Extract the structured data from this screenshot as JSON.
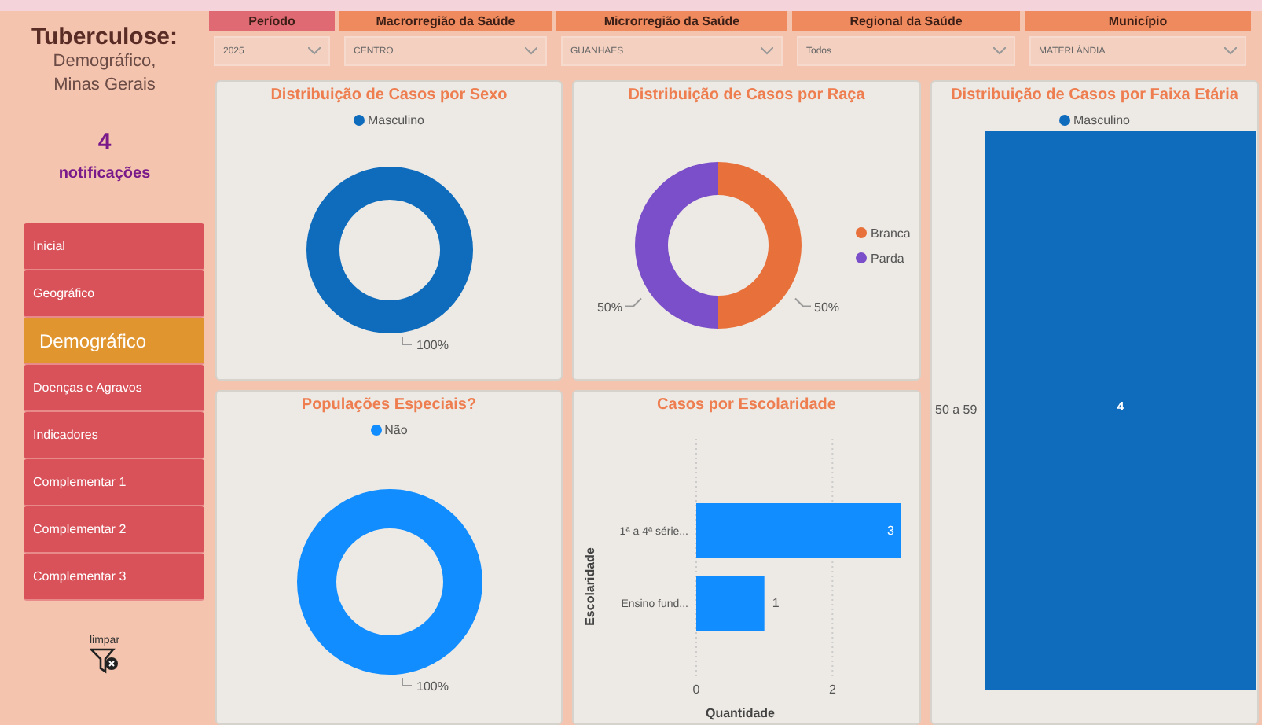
{
  "sidebar": {
    "title": "Tuberculose:",
    "subtitle": "Demográfico, Minas Gerais",
    "count": "4",
    "count_label": "notificações",
    "items": [
      {
        "label": "Inicial",
        "selected": false
      },
      {
        "label": "Geográfico",
        "selected": false
      },
      {
        "label": "Demográfico",
        "selected": true
      },
      {
        "label": "Doenças e Agravos",
        "selected": false
      },
      {
        "label": "Indicadores",
        "selected": false
      },
      {
        "label": "Complementar 1",
        "selected": false
      },
      {
        "label": "Complementar 2",
        "selected": false
      },
      {
        "label": "Complementar 3",
        "selected": false
      }
    ],
    "clear_label": "limpar"
  },
  "filters": [
    {
      "label": "Período",
      "value": "2025",
      "color": "#e06a74"
    },
    {
      "label": "Macrorregião da Saúde",
      "value": "CENTRO",
      "color": "#ee8a5e"
    },
    {
      "label": "Microrregião da Saúde",
      "value": "GUANHAES",
      "color": "#ee8a5e"
    },
    {
      "label": "Regional da Saúde",
      "value": "Todos",
      "color": "#ee8a5e"
    },
    {
      "label": "Município",
      "value": "MATERLÂNDIA",
      "color": "#ee8a5e"
    }
  ],
  "charts": [
    {
      "kind": "donut",
      "chart_data": {
        "type": "pie",
        "legend": "top",
        "title": "Distribuição de Casos por Sexo",
        "categories": [
          "Masculino"
        ],
        "values": [
          100
        ],
        "colors": [
          "#0f6cbd"
        ],
        "value_labels": [
          "100%"
        ]
      }
    },
    {
      "kind": "donut",
      "chart_data": {
        "type": "donut",
        "legend": "right",
        "title": "Distribuição de Casos por Raça",
        "categories": [
          "Branca",
          "Parda"
        ],
        "values": [
          50,
          50
        ],
        "colors": [
          "#e8703a",
          "#7b4fc9"
        ],
        "value_labels": [
          "50%",
          "50%"
        ]
      }
    },
    {
      "kind": "age_bar",
      "title": "Distribuição de Casos por Faixa Etária",
      "legend": "Masculino",
      "color": "#0f6cbd",
      "category": "50 a 59",
      "value": "4"
    },
    {
      "kind": "donut",
      "chart_data": {
        "type": "pie",
        "legend": "top",
        "title": "Populações Especiais?",
        "categories": [
          "Não"
        ],
        "values": [
          100
        ],
        "colors": [
          "#118dff"
        ],
        "value_labels": [
          "100%"
        ]
      }
    },
    {
      "kind": "bar",
      "chart_data": {
        "type": "bar",
        "orientation": "horizontal",
        "title": "Casos por Escolaridade",
        "xlabel": "Quantidade",
        "ylabel": "Escolaridade",
        "categories": [
          "1ª a 4ª série...",
          "Ensino fund..."
        ],
        "values": [
          3,
          1
        ],
        "color": "#118dff",
        "xlim": [
          0,
          3
        ],
        "xticks": [
          0,
          2
        ],
        "data_labels": true
      }
    }
  ]
}
